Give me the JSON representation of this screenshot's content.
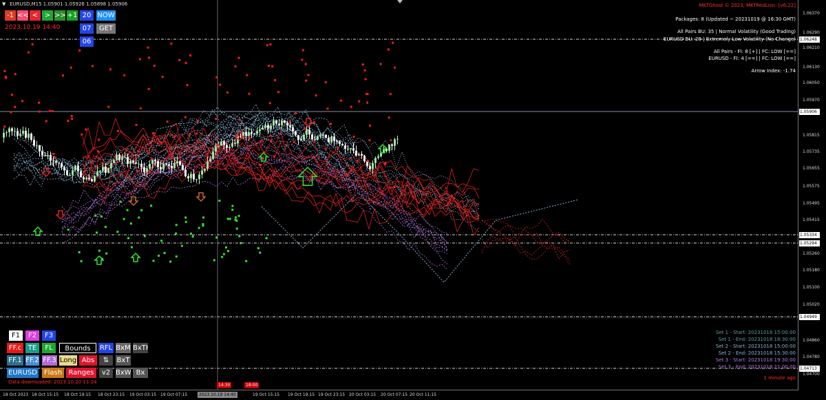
{
  "chart_header": "EURUSD,M15  1.05901 1.05926 1.05898 1.05906",
  "nav": {
    "minus1": "-1",
    "rew": "<<",
    "back": "<",
    "fwd": ">",
    "ffwd": ">>",
    "plus1": "+1",
    "num20": "20",
    "now": "NOW",
    "num07": "07",
    "get": "GET",
    "num06": "06",
    "datetime": "2023.10.19 14:40"
  },
  "info": {
    "copyright": "MKTGhost © 2023, MKTRedLion. [v6.22]",
    "packages": "Packages: 8 (Updated ~ 20231019 @ 16:30 GMT)",
    "all_pairs_bu": "All Pairs BU: 35 | Normal Volatility (Good Trading)",
    "eurusd_bu": "EURUSD BU: 28 | Extremely Low Volatility (No Change)",
    "all_pairs_fi": "All Pairs - FI: 8 [+] | FC: LOW [==]",
    "eurusd_fi": "EURUSD - FI: 4 [==] | FC: LOW [==]",
    "arrow_index": "Arrow Index: -1.74"
  },
  "sets": [
    {
      "text": "Set 1 - Start: 20231018 15:00:00",
      "color": "#5f9ea0"
    },
    {
      "text": "Set 1 - End: 20231018 18:30:00",
      "color": "#5f9ea0"
    },
    {
      "text": "Set 2 - Start: 20231018 15:00:00",
      "color": "#87b6d9"
    },
    {
      "text": "Set 2 - End: 20231018 15:30:00",
      "color": "#87b6d9"
    },
    {
      "text": "Set 3 - Start: 20231018 19:30:00",
      "color": "#b678e0"
    },
    {
      "text": "Set 3 - End: 20231018 21:00:00",
      "color": "#b678e0"
    }
  ],
  "one_minute_ago": "1 minute ago",
  "data_downloaded": "Data downloaded: 2023.10.20 11:24",
  "buttons": {
    "f1": "F1",
    "f2": "F2",
    "f3": "F3",
    "ffc": "FF.c",
    "te": "TE",
    "fl": "FL",
    "bounds": "Bounds",
    "rfl": "RFL",
    "bxm": "BxM",
    "bxth": "BxTH",
    "ff1": "FF.1",
    "ff2": "FF.2",
    "ff3": "FF.3",
    "long": "Long",
    "abs": "Abs",
    "updown": "⇅",
    "bxt": "BxT",
    "eurusd": "EURUSD",
    "flash": "Flash",
    "ranges": "Ranges",
    "v2": "v2",
    "bxw": "BxW",
    "bx": "Bx"
  },
  "price_axis": {
    "labels": [
      "1.06370",
      "1.06290",
      "1.06210",
      "1.06130",
      "1.06050",
      "1.05970",
      "1.05815",
      "1.05735",
      "1.05655",
      "1.05575",
      "1.05495",
      "1.05415",
      "1.05260",
      "1.05180",
      "1.05100",
      "1.05020",
      "1.04860",
      "1.04780",
      "1.04700"
    ],
    "tags": [
      "1.06248",
      "1.05906",
      "1.05334",
      "1.05294",
      "1.04949",
      "1.04713"
    ]
  },
  "time_axis": {
    "labels": [
      "18 Oct 2023",
      "18 Oct 15:15",
      "18 Oct 19:15",
      "18 Oct 23:15",
      "19 Oct 03:15",
      "19 Oct 07:15",
      "19 Oct 15:15",
      "19 Oct 19:15",
      "19 Oct 23:15",
      "20 Oct 03:15",
      "20 Oct 07:15",
      "20 Oct 11:15"
    ],
    "cursor": "2023.10.19 14:40",
    "marker_1430": "14:30",
    "marker_1800": "18:00"
  },
  "colors": {
    "bull": "#ff3b3b",
    "bear": "#b3f0b3",
    "set1": "#5f9ea0",
    "set2": "#87b6d9",
    "set3": "#b678e0",
    "red_proj": "#e02020"
  }
}
